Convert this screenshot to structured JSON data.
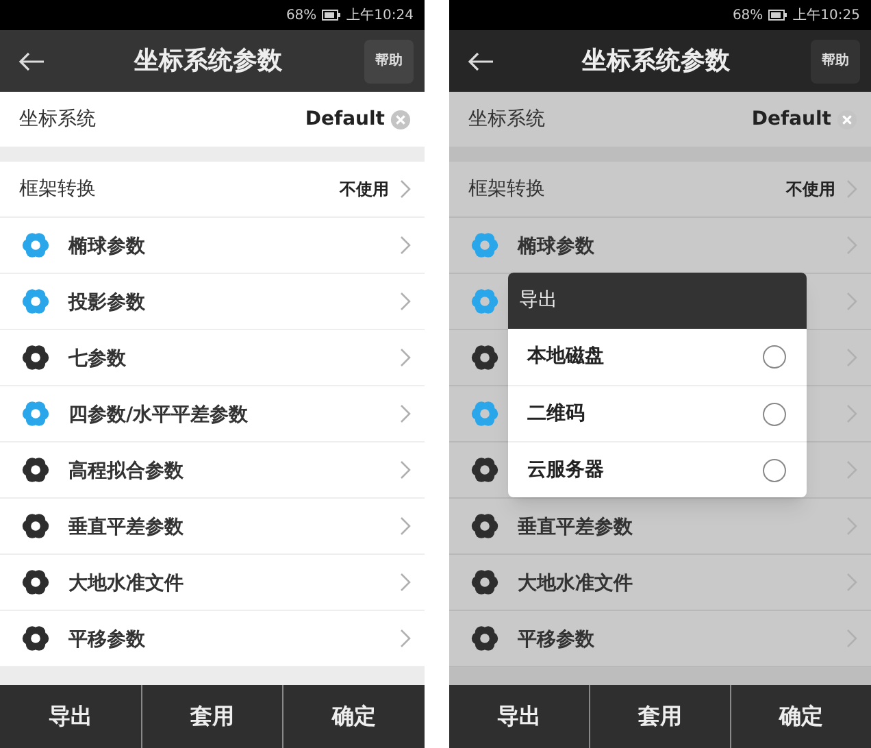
{
  "phones": [
    {
      "status_bar": {
        "battery": "68%",
        "time": "上午10:24"
      },
      "header": {
        "title": "坐标系统参数",
        "help": "帮助"
      },
      "coordinate_system": {
        "label": "坐标系统",
        "value": "Default"
      },
      "frame_conversion": {
        "label": "框架转换",
        "value": "不使用"
      },
      "items": [
        {
          "label": "椭球参数",
          "color": "#2aa6ea"
        },
        {
          "label": "投影参数",
          "color": "#2aa6ea"
        },
        {
          "label": "七参数",
          "color": "#2e2e2e"
        },
        {
          "label": "四参数/水平平差参数",
          "color": "#2aa6ea"
        },
        {
          "label": "高程拟合参数",
          "color": "#2e2e2e"
        },
        {
          "label": "垂直平差参数",
          "color": "#2e2e2e"
        },
        {
          "label": "大地水准文件",
          "color": "#2e2e2e"
        },
        {
          "label": "平移参数",
          "color": "#2e2e2e"
        }
      ],
      "footer": [
        "导出",
        "套用",
        "确定"
      ]
    },
    {
      "status_bar": {
        "battery": "68%",
        "time": "上午10:25"
      },
      "header": {
        "title": "坐标系统参数",
        "help": "帮助"
      },
      "coordinate_system": {
        "label": "坐标系统",
        "value": "Default"
      },
      "frame_conversion": {
        "label": "框架转换",
        "value": "不使用"
      },
      "items": [
        {
          "label": "椭球参数",
          "color": "#2aa6ea"
        },
        {
          "color": "#2aa6ea"
        },
        {
          "color": "#2e2e2e"
        },
        {
          "color": "#2aa6ea"
        },
        {
          "color": "#2e2e2e"
        },
        {
          "label": "垂直平差参数",
          "color": "#2e2e2e"
        },
        {
          "label": "大地水准文件",
          "color": "#2e2e2e"
        },
        {
          "label": "平移参数",
          "color": "#2e2e2e"
        }
      ],
      "footer": [
        "导出",
        "套用",
        "确定"
      ],
      "dialog": {
        "title": "导出",
        "options": [
          {
            "label": "本地磁盘",
            "selected": false
          },
          {
            "label": "二维码",
            "selected": false
          },
          {
            "label": "云服务器",
            "selected": false
          }
        ]
      }
    }
  ]
}
